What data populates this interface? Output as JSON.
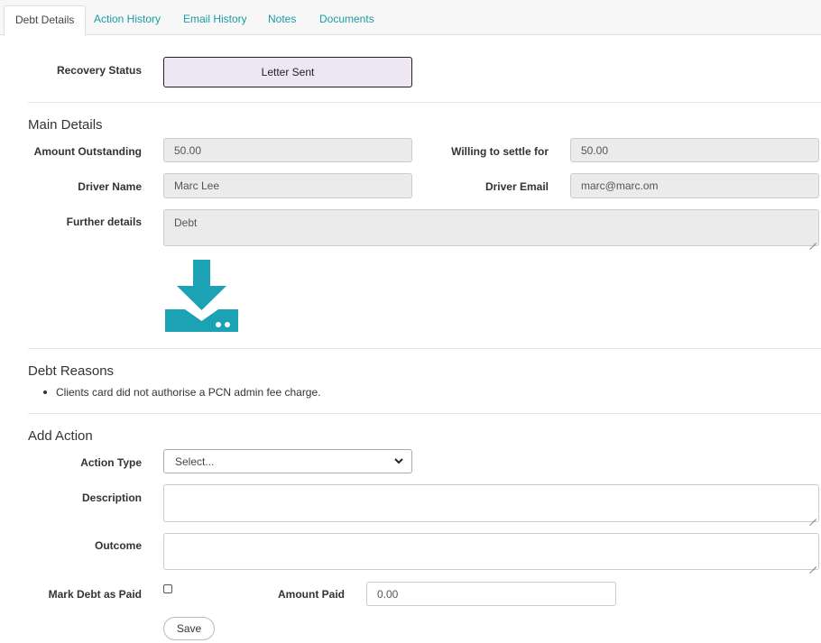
{
  "tabs": [
    {
      "label": "Debt Details",
      "active": true
    },
    {
      "label": "Action History",
      "active": false
    },
    {
      "label": "Email History",
      "active": false
    },
    {
      "label": "Notes",
      "active": false
    },
    {
      "label": "Documents",
      "active": false
    }
  ],
  "recovery": {
    "label": "Recovery Status",
    "value": "Letter Sent"
  },
  "main": {
    "heading": "Main Details",
    "amount_outstanding": {
      "label": "Amount Outstanding",
      "value": "50.00"
    },
    "willing_to_settle": {
      "label": "Willing to settle for",
      "value": "50.00"
    },
    "driver_name": {
      "label": "Driver Name",
      "value": "Marc Lee"
    },
    "driver_email": {
      "label": "Driver Email",
      "value": "marc@marc.om"
    },
    "further_details": {
      "label": "Further details",
      "value": "Debt"
    },
    "download_icon": "download-icon"
  },
  "reasons": {
    "heading": "Debt Reasons",
    "items": [
      "Clients card did not authorise a PCN admin fee charge."
    ]
  },
  "add_action": {
    "heading": "Add Action",
    "action_type": {
      "label": "Action Type",
      "selected": "Select..."
    },
    "description": {
      "label": "Description",
      "value": ""
    },
    "outcome": {
      "label": "Outcome",
      "value": ""
    },
    "mark_paid": {
      "label": "Mark Debt as Paid",
      "checked": false
    },
    "amount_paid": {
      "label": "Amount Paid",
      "value": "0.00"
    },
    "save_label": "Save"
  },
  "colors": {
    "accent": "#1ba3b5",
    "status_bg": "#ede6f3",
    "field_bg": "#ebebeb"
  }
}
